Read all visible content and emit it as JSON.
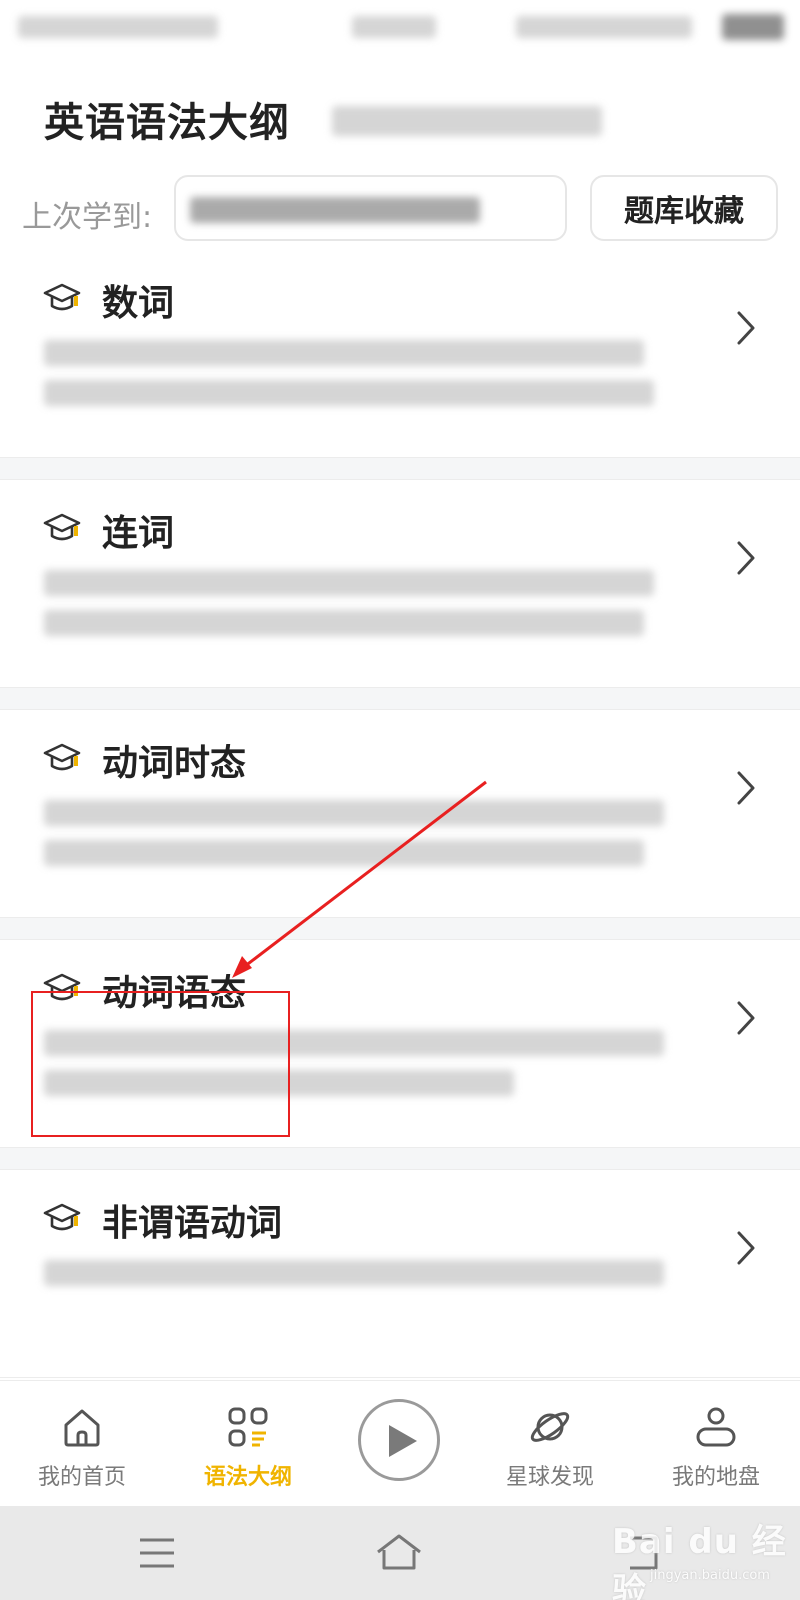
{
  "header": {
    "title": "英语语法大纲",
    "last_learned_label": "上次学到:",
    "favorites_button": "题库收藏"
  },
  "items": [
    {
      "title": "数词"
    },
    {
      "title": "连词"
    },
    {
      "title": "动词时态"
    },
    {
      "title": "动词语态",
      "highlighted": true
    },
    {
      "title": "非谓语动词"
    }
  ],
  "tabbar": {
    "tabs": [
      {
        "label": "我的首页",
        "icon": "home-icon"
      },
      {
        "label": "语法大纲",
        "icon": "grid-list-icon",
        "active": true
      },
      {
        "label": "星球发现",
        "icon": "planet-icon"
      },
      {
        "label": "我的地盘",
        "icon": "user-icon"
      }
    ],
    "center_icon": "play-icon"
  },
  "watermark": {
    "text": "Bai du 经验",
    "url": "jingyan.baidu.com"
  },
  "colors": {
    "accent": "#f0b400",
    "annotation": "#e82020",
    "separator": "#f5f6f7"
  }
}
